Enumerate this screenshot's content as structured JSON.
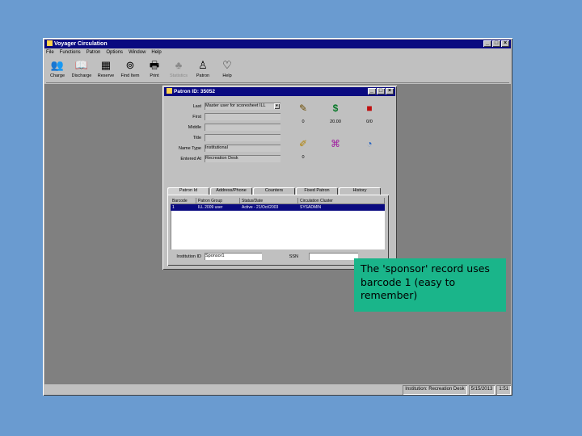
{
  "app": {
    "title": "Voyager Circulation",
    "window_buttons": [
      "_",
      "□",
      "×"
    ],
    "menu": [
      "File",
      "Functions",
      "Patron",
      "Options",
      "Window",
      "Help"
    ],
    "toolbar": [
      {
        "label": "Charge",
        "icon": "people-icon",
        "glyph": "👥",
        "enabled": true
      },
      {
        "label": "Discharge",
        "icon": "book-return-icon",
        "glyph": "📖",
        "enabled": true
      },
      {
        "label": "Reserve",
        "icon": "reserve-icon",
        "glyph": "▦",
        "enabled": true
      },
      {
        "label": "Find Item",
        "icon": "binoculars-icon",
        "glyph": "⊚",
        "enabled": true
      },
      {
        "label": "Print",
        "icon": "printer-icon",
        "glyph": "🖶",
        "enabled": true
      },
      {
        "label": "Statistics",
        "icon": "tree-icon",
        "glyph": "♣",
        "enabled": false
      },
      {
        "label": "Patron",
        "icon": "person-icon",
        "glyph": "♙",
        "enabled": true
      },
      {
        "label": "Help",
        "icon": "heart-help-icon",
        "glyph": "♡",
        "enabled": true
      }
    ],
    "status": [
      "Institution: Recreation Desk",
      "5/15/2013",
      "1:51"
    ]
  },
  "patron_window": {
    "title": "Patron ID: 35052",
    "fields": [
      {
        "label": "Last",
        "value": "Master user for scoresheet ILL",
        "dropdown": true
      },
      {
        "label": "First",
        "value": ""
      },
      {
        "label": "Middle",
        "value": ""
      },
      {
        "label": "Title",
        "value": ""
      },
      {
        "label": "Name Type",
        "value": "Institutional"
      },
      {
        "label": "Entered At",
        "value": "Recreation Desk"
      }
    ],
    "counts": {
      "charges": "0",
      "fines": "20.00",
      "requests": "0/0",
      "notes": "0"
    },
    "tabs": [
      "Patron Id",
      "Address/Phone",
      "Counters",
      "Fixed Patron",
      "History"
    ],
    "grid": {
      "headers": [
        "Barcode",
        "Patron Group",
        "Status/Date",
        "Circulation Cluster"
      ],
      "rows": [
        [
          "1",
          "ILL 2009 user",
          "Active - 21/Oct/2003",
          "SYSADMIN"
        ]
      ]
    },
    "institution_label": "Institution ID",
    "institution_value": "Sponsor1",
    "ssn_label": "SSN",
    "ssn_value": ""
  },
  "callout": {
    "text": "The 'sponsor' record uses barcode 1 (easy to remember)"
  },
  "colors": {
    "desktop": "#6a9bd0",
    "titlebar": "#0a0a80",
    "callout": "#1ab58a"
  }
}
